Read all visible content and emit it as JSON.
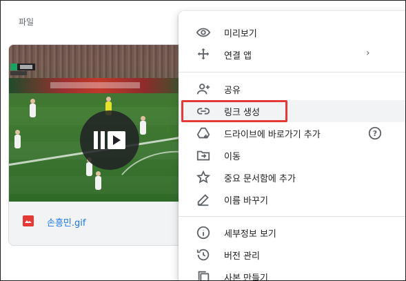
{
  "section": {
    "title": "파일",
    "sort_arrow": "↑"
  },
  "file": {
    "name": "손흥민.gif",
    "type_icon": "gif-image-icon",
    "thumbnail": "soccer-match-animation",
    "overlay_icon": "animated-gif-play-icon"
  },
  "menu": {
    "items": [
      {
        "label": "미리보기",
        "icon": "eye-icon"
      },
      {
        "label": "연결 앱",
        "icon": "move-arrows-icon",
        "chevron": "›"
      },
      {
        "label": "공유",
        "icon": "person-add-icon"
      },
      {
        "label": "링크 생성",
        "icon": "link-icon",
        "highlighted": true
      },
      {
        "label": "드라이브에 바로가기 추가",
        "icon": "add-shortcut-icon",
        "help": "?"
      },
      {
        "label": "이동",
        "icon": "move-to-folder-icon"
      },
      {
        "label": "중요 문서함에 추가",
        "icon": "star-icon"
      },
      {
        "label": "이름 바꾸기",
        "icon": "pencil-icon"
      },
      {
        "label": "세부정보 보기",
        "icon": "info-icon"
      },
      {
        "label": "버전 관리",
        "icon": "history-icon"
      },
      {
        "label": "사본 만들기",
        "icon": "copy-icon"
      }
    ]
  },
  "colors": {
    "accent": "#1a73e8",
    "highlight_border": "#e53935",
    "hover_bg": "#f1f3f4",
    "icon_gray": "#5f6368"
  }
}
